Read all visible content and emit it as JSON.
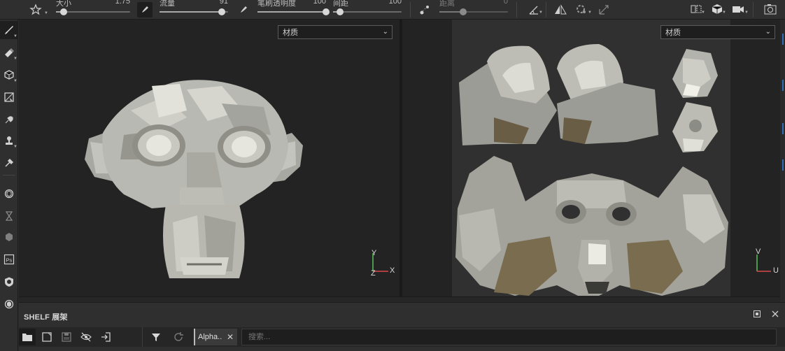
{
  "toolbar": {
    "size_label": "大小",
    "size_value": "1.75",
    "size_level": 0.1,
    "flow_label": "流量",
    "flow_value": "91",
    "flow_level": 0.91,
    "opacity_label": "笔刷透明度",
    "opacity_value": "100",
    "opacity_level": 1.0,
    "spacing_label": "间距",
    "spacing_value": "100",
    "spacing_level": 0.1,
    "distance_label": "距离",
    "distance_value": "0",
    "distance_level": 0.35
  },
  "viewport_left": {
    "material_dropdown": "材质",
    "axis_x": "X",
    "axis_y": "Y",
    "axis_z": "Z"
  },
  "viewport_right": {
    "material_dropdown": "材质",
    "axis_u": "U",
    "axis_v": "V"
  },
  "shelf": {
    "title": "SHELF 展架",
    "tag_label": "Alpha..",
    "search_placeholder": "搜索..."
  },
  "colors": {
    "accent": "#2f6fb5",
    "background": "#232323",
    "panel": "#2f2f2f"
  }
}
